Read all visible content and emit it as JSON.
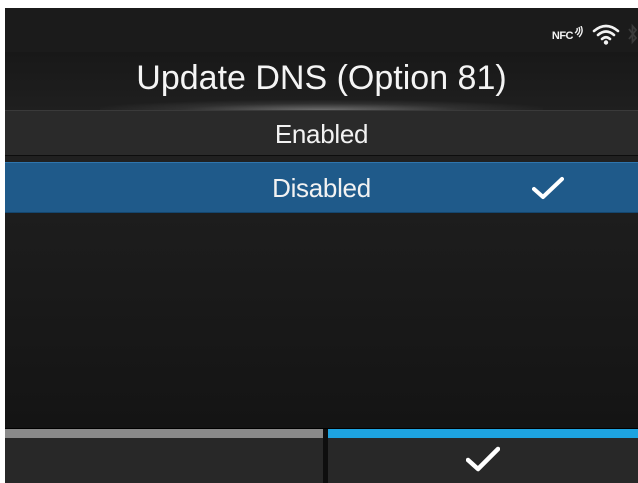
{
  "status": {
    "nfc_label": "NFC"
  },
  "header": {
    "title": "Update DNS (Option 81)"
  },
  "options": [
    {
      "label": "Enabled",
      "selected": false
    },
    {
      "label": "Disabled",
      "selected": true
    }
  ],
  "icons": {
    "nfc": "nfc-icon",
    "wifi": "wifi-icon",
    "bluetooth": "bluetooth-icon",
    "selected_check": "check-icon",
    "confirm": "check-icon"
  },
  "colors": {
    "selection": "#1f5a8a",
    "left_softkey_bar": "#8a8a8a",
    "right_softkey_bar": "#1ea3e0",
    "background": "#1b1b1b"
  }
}
